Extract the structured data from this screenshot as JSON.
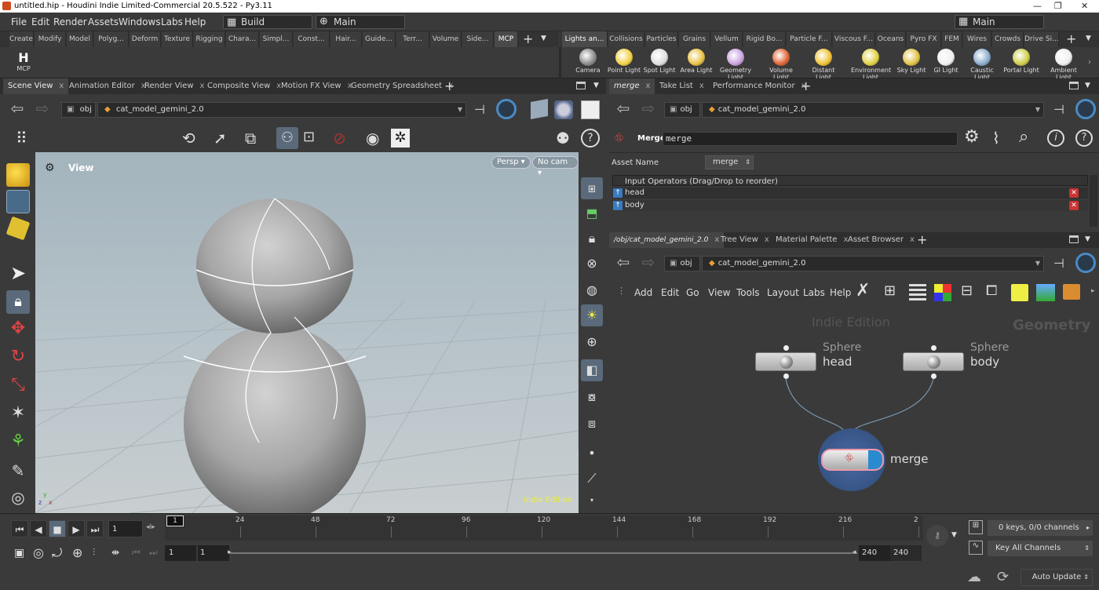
{
  "window": {
    "title": "untitled.hip - Houdini Indie Limited-Commercial 20.5.522 - Py3.11",
    "min": "—",
    "restore": "❐",
    "close": "✕"
  },
  "menu": {
    "items": [
      "File",
      "Edit",
      "Render",
      "Assets",
      "Windows",
      "Labs",
      "Help"
    ],
    "desktop": "Build",
    "context": "Main",
    "right_desktop": "Main"
  },
  "shelf_left": {
    "tabs": [
      "Create",
      "Modify",
      "Model",
      "Polyg...",
      "Deform",
      "Texture",
      "Rigging",
      "Chara...",
      "Simpl...",
      "Const...",
      "Hair...",
      "Guide...",
      "Terr...",
      "Volume",
      "Side...",
      "MCP"
    ],
    "active": "MCP",
    "tool": {
      "glyph": "H",
      "label": "MCP"
    },
    "add": "+",
    "chevron": "▼"
  },
  "shelf_right": {
    "tabs": [
      "Lights an...",
      "Collisions",
      "Particles",
      "Grains",
      "Vellum",
      "Rigid Bo...",
      "Particle F...",
      "Viscous F...",
      "Oceans",
      "Pyro FX",
      "FEM",
      "Wires",
      "Crowds",
      "Drive Si..."
    ],
    "tools": [
      {
        "label": "Camera",
        "color": "#888"
      },
      {
        "label": "Point Light",
        "color": "#f0d040"
      },
      {
        "label": "Spot Light",
        "color": "#ddd"
      },
      {
        "label": "Area Light",
        "color": "#e8c040"
      },
      {
        "label": "Geometry Light",
        "color": "#c8a0e0"
      },
      {
        "label": "Volume Light",
        "color": "#e06030"
      },
      {
        "label": "Distant Light",
        "color": "#f0c030"
      },
      {
        "label": "Environment Light",
        "color": "#e0d040"
      },
      {
        "label": "Sky Light",
        "color": "#e0c040"
      },
      {
        "label": "GI Light",
        "color": "#eee"
      },
      {
        "label": "Caustic Light",
        "color": "#8ac"
      },
      {
        "label": "Portal Light",
        "color": "#cc4"
      },
      {
        "label": "Ambient Light",
        "color": "#eee"
      }
    ]
  },
  "scene": {
    "tabs": [
      "Scene View",
      "Animation Editor",
      "Render View",
      "Composite View",
      "Motion FX View",
      "Geometry Spreadsheet"
    ],
    "close": "x",
    "add": "+",
    "path_root": "obj",
    "path_node": "cat_model_gemini_2.0",
    "view_label": "View",
    "persp": "Persp",
    "nocam": "No cam",
    "watermark": "Indie Edition",
    "axis": {
      "y": "y",
      "z": "z",
      "x": "x"
    }
  },
  "params": {
    "tabs": [
      "merge",
      "Take List",
      "Performance Monitor"
    ],
    "node_type": "Merge",
    "node_name": "merge",
    "asset_label": "Asset Name",
    "asset_value": "merge",
    "input_header": "Input Operators (Drag/Drop to reorder)",
    "inputs": [
      "head",
      "body"
    ]
  },
  "network": {
    "tabs": [
      "/obj/cat_model_gemini_2.0",
      "Tree View",
      "Material Palette",
      "Asset Browser"
    ],
    "path_root": "obj",
    "path_node": "cat_model_gemini_2.0",
    "menu": [
      "Add",
      "Edit",
      "Go",
      "View",
      "Tools",
      "Layout",
      "Labs",
      "Help"
    ],
    "watermark": "Indie Edition",
    "context": "Geometry",
    "nodes": [
      {
        "type": "Sphere",
        "name": "head"
      },
      {
        "type": "Sphere",
        "name": "body"
      },
      {
        "type": "",
        "name": "merge"
      }
    ]
  },
  "timeline": {
    "current_frame": "1",
    "frame_marker": "1",
    "ticks": [
      "24",
      "48",
      "72",
      "96",
      "120",
      "144",
      "168",
      "192",
      "216",
      "2"
    ],
    "start": "1",
    "range_start": "1",
    "range_end": "240",
    "end": "240",
    "keys": "0 keys, 0/0 channels",
    "key_all": "Key All Channels",
    "auto_update": "Auto Update"
  }
}
